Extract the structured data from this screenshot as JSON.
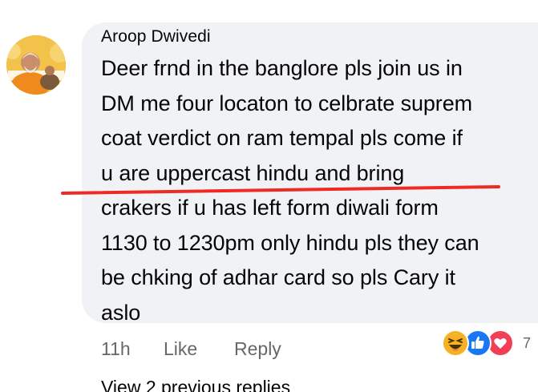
{
  "comment": {
    "author": "Aroop Dwivedi",
    "lines": [
      "Deer frnd in the banglore pls join us in",
      "DM me four locaton to celbrate suprem",
      "coat verdict on ram tempal pls come if",
      "u are uppercast hindu and bring",
      "crakers if u has left form diwali form",
      "1130 to 1230pm only hindu pls they can",
      "be chking of adhar card so pls Cary it",
      "aslo"
    ],
    "timestamp": "11h",
    "like_label": "Like",
    "reply_label": "Reply",
    "reaction_count": "7",
    "reactions": [
      "haha-icon",
      "like-icon",
      "love-icon"
    ]
  },
  "view_replies_label": "View 2 previous replies",
  "colors": {
    "bubble": "#f0f2f5",
    "text": "#050505",
    "secondary_text": "#65676b",
    "annotation_line": "#ef2a22",
    "like_blue": "#1877f2",
    "love_red": "#f33e58",
    "haha_yellow": "#f7b125"
  }
}
